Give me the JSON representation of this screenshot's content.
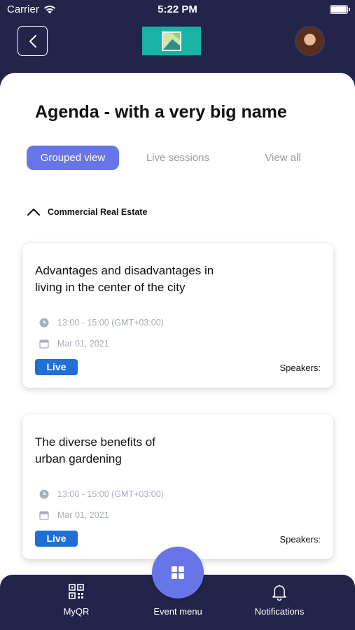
{
  "status_bar": {
    "carrier": "Carrier",
    "time": "5:22 PM"
  },
  "header": {
    "back_icon": "chevron-left-icon",
    "logo": "event-logo",
    "avatar": "user-avatar"
  },
  "page": {
    "title": "Agenda - with a very big name"
  },
  "tabs": [
    {
      "label": "Grouped view",
      "active": true
    },
    {
      "label": "Live sessions",
      "active": false
    },
    {
      "label": "View all",
      "active": false
    }
  ],
  "group": {
    "name": "Commercial Real Estate",
    "expanded": true
  },
  "sessions": [
    {
      "title_line1": "Advantages and disadvantages in",
      "title_line2": "living in the center of the city",
      "time": "13:00 - 15:00 (GMT+03:00)",
      "date": "Mar 01, 2021",
      "badge": "Live",
      "speakers_label": "Speakers:"
    },
    {
      "title_line1": "The diverse benefits of",
      "title_line2": "urban gardening",
      "time": "13:00 - 15:00 (GMT+03:00)",
      "date": "Mar 01, 2021",
      "badge": "Live",
      "speakers_label": "Speakers:"
    }
  ],
  "bottom_nav": {
    "myqr_label": "MyQR",
    "event_menu_label": "Event menu",
    "notifications_label": "Notifications"
  },
  "colors": {
    "navy": "#23244a",
    "accent": "#6875e8",
    "live_badge": "#1f6fd6",
    "logo_teal": "#19b3a6"
  }
}
